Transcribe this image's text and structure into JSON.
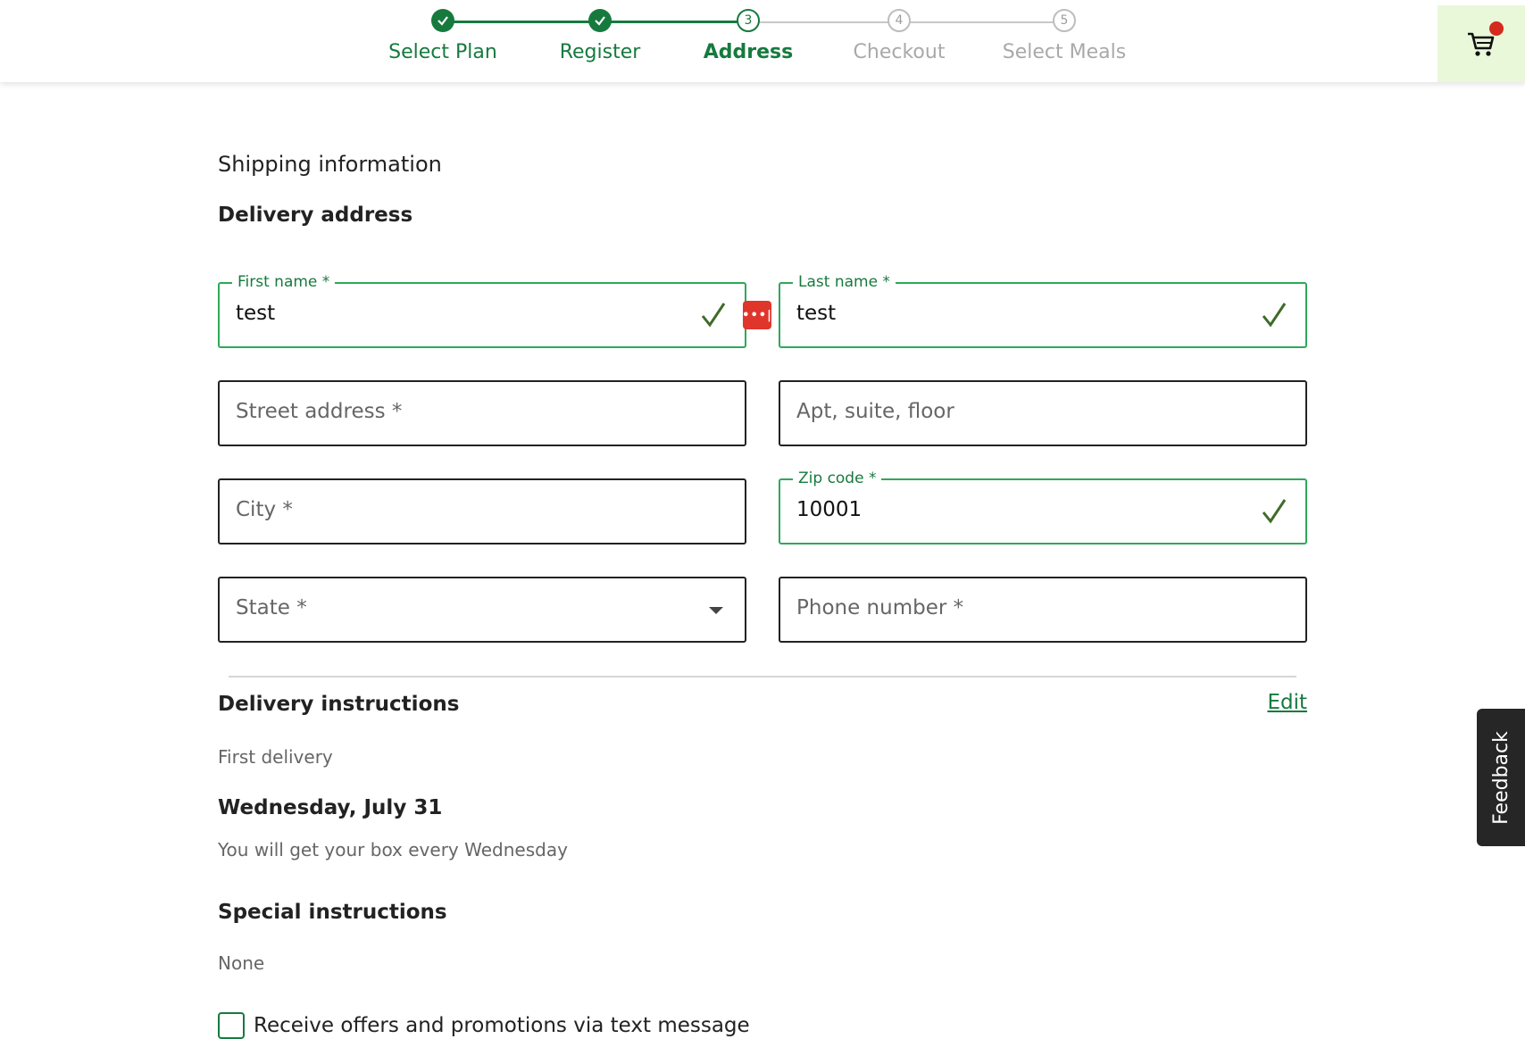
{
  "stepper": {
    "steps": [
      {
        "label": "Select Plan",
        "state": "done",
        "number": "1"
      },
      {
        "label": "Register",
        "state": "done",
        "number": "2"
      },
      {
        "label": "Address",
        "state": "current",
        "number": "3"
      },
      {
        "label": "Checkout",
        "state": "todo",
        "number": "4"
      },
      {
        "label": "Select Meals",
        "state": "todo",
        "number": "5"
      }
    ]
  },
  "cart": {
    "icon": "cart-icon",
    "has_badge": true
  },
  "form": {
    "section_title": "Shipping information",
    "heading": "Delivery address",
    "first_name": {
      "label": "First name *",
      "value": "test"
    },
    "last_name": {
      "label": "Last name *",
      "value": "test"
    },
    "street": {
      "placeholder": "Street address *"
    },
    "apt": {
      "placeholder": "Apt, suite, floor"
    },
    "city": {
      "placeholder": "City *"
    },
    "zip": {
      "label": "Zip code *",
      "value": "10001"
    },
    "state": {
      "placeholder": "State *"
    },
    "phone": {
      "placeholder": "Phone number *"
    }
  },
  "delivery": {
    "heading": "Delivery instructions",
    "edit_label": "Edit",
    "first_delivery_label": "First delivery",
    "date": "Wednesday, July 31",
    "recurrence": "You will get your box every Wednesday",
    "special_heading": "Special instructions",
    "special_value": "None"
  },
  "promo": {
    "label": "Receive offers and promotions via text message",
    "checked": false
  },
  "feedback": {
    "label": "Feedback"
  },
  "colors": {
    "brand_green": "#167a3e",
    "valid_border": "#2ea85a",
    "cart_bg": "#e9f8d8",
    "badge_red": "#d42a1f"
  }
}
